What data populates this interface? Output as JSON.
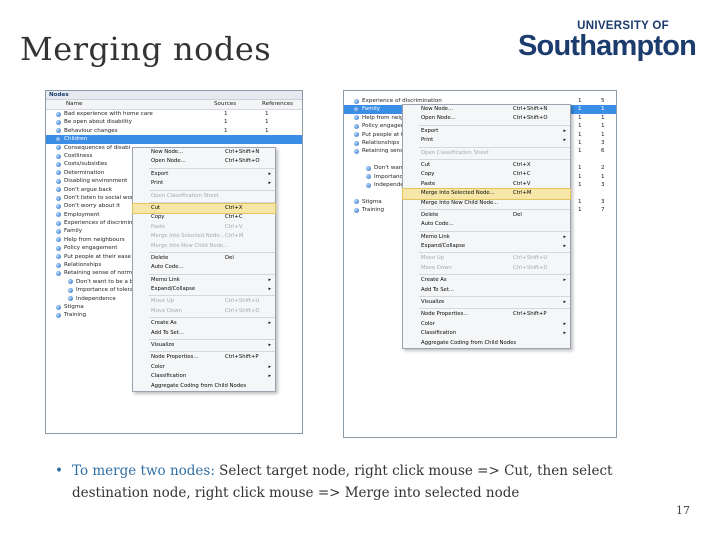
{
  "slide": {
    "title": "Merging nodes",
    "logo_top": "UNIVERSITY OF",
    "logo_name": "Southampton",
    "bullet_lead": "To merge two nodes:",
    "bullet_text": " Select target node, right click mouse => Cut, then select destination node, right click mouse => Merge into selected node",
    "page_number": "17"
  },
  "left_panel": {
    "header": "Nodes",
    "columns": [
      "Name",
      "Sources",
      "References"
    ],
    "rows": [
      {
        "label": "Bad experience with home care",
        "s": "1",
        "r": "1"
      },
      {
        "label": "Be open about disability",
        "s": "1",
        "r": "1"
      },
      {
        "label": "Behaviour changes",
        "s": "1",
        "r": "1"
      },
      {
        "label": "Children",
        "s": "",
        "r": "",
        "selected": true
      },
      {
        "label": "Consequences of disabi",
        "s": "",
        "r": ""
      },
      {
        "label": "Costliness",
        "s": "",
        "r": ""
      },
      {
        "label": "Costs/subsidies",
        "s": "",
        "r": ""
      },
      {
        "label": "Determination",
        "s": "",
        "r": ""
      },
      {
        "label": "Disabling environment",
        "s": "",
        "r": ""
      },
      {
        "label": "Don't argue back",
        "s": "",
        "r": ""
      },
      {
        "label": "Don't listen to social work",
        "s": "",
        "r": ""
      },
      {
        "label": "Don't worry about it",
        "s": "",
        "r": ""
      },
      {
        "label": "Employment",
        "s": "",
        "r": ""
      },
      {
        "label": "Experiences of discrimina",
        "s": "",
        "r": ""
      },
      {
        "label": "Family",
        "s": "",
        "r": ""
      },
      {
        "label": "Help from neighbours",
        "s": "",
        "r": ""
      },
      {
        "label": "Policy engagement",
        "s": "",
        "r": ""
      },
      {
        "label": "Put people at their ease",
        "s": "",
        "r": ""
      },
      {
        "label": "Relationships",
        "s": "",
        "r": ""
      },
      {
        "label": "Retaining sense of norma",
        "s": "",
        "r": ""
      },
      {
        "label": "Don't want to be a bu",
        "s": "",
        "r": "",
        "indent": true
      },
      {
        "label": "Importance of toleran",
        "s": "",
        "r": "",
        "indent": true
      },
      {
        "label": "Independence",
        "s": "",
        "r": "",
        "indent": true
      },
      {
        "label": "Stigma",
        "s": "",
        "r": ""
      },
      {
        "label": "Training",
        "s": "",
        "r": ""
      }
    ],
    "menu": [
      {
        "label": "New Node...",
        "sc": "Ctrl+Shift+N"
      },
      {
        "label": "Open Node...",
        "sc": "Ctrl+Shift+O"
      },
      {
        "sep": true
      },
      {
        "label": "Export",
        "arrow": true
      },
      {
        "label": "Print",
        "arrow": true
      },
      {
        "sep": true
      },
      {
        "label": "Open Classification Sheet",
        "dis": true
      },
      {
        "sep": true
      },
      {
        "label": "Cut",
        "sc": "Ctrl+X",
        "hl": true
      },
      {
        "label": "Copy",
        "sc": "Ctrl+C"
      },
      {
        "label": "Paste",
        "sc": "Ctrl+V",
        "dis": true
      },
      {
        "label": "Merge Into Selected Node...",
        "sc": "Ctrl+M",
        "dis": true
      },
      {
        "label": "Merge Into New Child Node...",
        "dis": true
      },
      {
        "sep": true
      },
      {
        "label": "Delete",
        "sc": "Del"
      },
      {
        "label": "Auto Code...",
        "dis": false
      },
      {
        "sep": true
      },
      {
        "label": "Memo Link",
        "arrow": true
      },
      {
        "label": "Expand/Collapse",
        "arrow": true
      },
      {
        "sep": true
      },
      {
        "label": "Move Up",
        "sc": "Ctrl+Shift+U",
        "dis": true
      },
      {
        "label": "Move Down",
        "sc": "Ctrl+Shift+D",
        "dis": true
      },
      {
        "sep": true
      },
      {
        "label": "Create As",
        "arrow": true
      },
      {
        "label": "Add To Set...",
        "dis": false
      },
      {
        "sep": true
      },
      {
        "label": "Visualize",
        "arrow": true
      },
      {
        "sep": true
      },
      {
        "label": "Node Properties...",
        "sc": "Ctrl+Shift+P"
      },
      {
        "label": "Color",
        "arrow": true
      },
      {
        "label": "Classification",
        "arrow": true
      },
      {
        "label": "Aggregate Coding from Child Nodes"
      }
    ]
  },
  "right_panel": {
    "rows": [
      {
        "label": "Experience of discrimination",
        "s": "1",
        "r": "5"
      },
      {
        "label": "Family",
        "s": "1",
        "r": "1",
        "selected": true
      },
      {
        "label": "Help from neighbours",
        "s": "1",
        "r": "1"
      },
      {
        "label": "Policy engagement",
        "s": "1",
        "r": "1"
      },
      {
        "label": "Put people at their ease",
        "s": "1",
        "r": "1"
      },
      {
        "label": "Relationships",
        "s": "1",
        "r": "3"
      },
      {
        "label": "Retaining sense of normality",
        "s": "1",
        "r": "6"
      },
      {
        "label": "",
        "s": "",
        "r": ""
      },
      {
        "label": "Don't want to be a burden",
        "s": "1",
        "r": "2",
        "indent": true
      },
      {
        "label": "Importance of tolerance",
        "s": "1",
        "r": "1",
        "indent": true
      },
      {
        "label": "Independence",
        "s": "1",
        "r": "3",
        "indent": true
      },
      {
        "label": "",
        "s": "",
        "r": ""
      },
      {
        "label": "Stigma",
        "s": "1",
        "r": "3"
      },
      {
        "label": "Training",
        "s": "1",
        "r": "7"
      }
    ],
    "menu": [
      {
        "label": "New Node...",
        "sc": "Ctrl+Shift+N"
      },
      {
        "label": "Open Node...",
        "sc": "Ctrl+Shift+O"
      },
      {
        "sep": true
      },
      {
        "label": "Export",
        "arrow": true
      },
      {
        "label": "Print",
        "arrow": true
      },
      {
        "sep": true
      },
      {
        "label": "Open Classification Sheet",
        "dis": true
      },
      {
        "sep": true
      },
      {
        "label": "Cut",
        "sc": "Ctrl+X"
      },
      {
        "label": "Copy",
        "sc": "Ctrl+C"
      },
      {
        "label": "Paste",
        "sc": "Ctrl+V"
      },
      {
        "label": "Merge Into Selected Node...",
        "sc": "Ctrl+M",
        "hl": true
      },
      {
        "label": "Merge Into New Child Node..."
      },
      {
        "sep": true
      },
      {
        "label": "Delete",
        "sc": "Del"
      },
      {
        "label": "Auto Code..."
      },
      {
        "sep": true
      },
      {
        "label": "Memo Link",
        "arrow": true
      },
      {
        "label": "Expand/Collapse",
        "arrow": true
      },
      {
        "sep": true
      },
      {
        "label": "Move Up",
        "sc": "Ctrl+Shift+U",
        "dis": true
      },
      {
        "label": "Move Down",
        "sc": "Ctrl+Shift+D",
        "dis": true
      },
      {
        "sep": true
      },
      {
        "label": "Create As",
        "arrow": true
      },
      {
        "label": "Add To Set..."
      },
      {
        "sep": true
      },
      {
        "label": "Visualize",
        "arrow": true
      },
      {
        "sep": true
      },
      {
        "label": "Node Properties...",
        "sc": "Ctrl+Shift+P"
      },
      {
        "label": "Color",
        "arrow": true
      },
      {
        "label": "Classification",
        "arrow": true
      },
      {
        "label": "Aggregate Coding from Child Nodes"
      }
    ]
  }
}
